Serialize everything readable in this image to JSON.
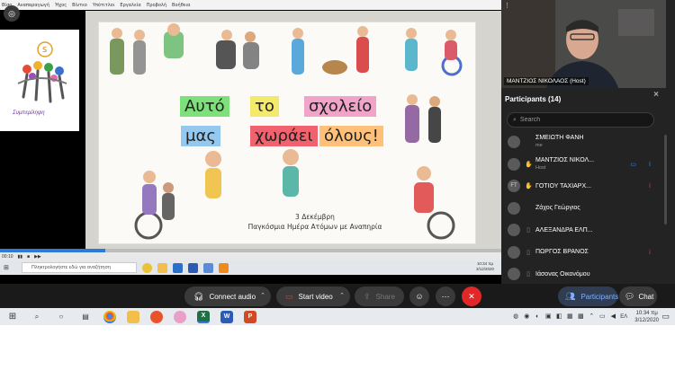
{
  "share": {
    "menu": [
      "Βίσο",
      "Αναπαραγωγή",
      "Ήχος",
      "Βίντεο",
      "Υπότιτλοι",
      "Εργαλεία",
      "Προβολή",
      "Βοήθεια"
    ],
    "logo_caption": "Συμπερίληψη",
    "poster": {
      "title_words": [
        "Αυτό",
        "το",
        "σχολείο",
        "μας",
        "χωράει",
        "όλους!"
      ],
      "caption_line1": "3 Δεκέμβρη",
      "caption_line2": "Παγκόσμια Ημέρα Ατόμων με Αναπηρία"
    },
    "progress": 0.21,
    "time_left": "00:10",
    "taskbar_search_placeholder": "Πληκτρολογήστε εδώ για αναζήτηση",
    "time": "10:34 πμ",
    "date": "3/12/2020",
    "lang": "ΕΛ"
  },
  "camera": {
    "label": "ΜΑΝΤΖΙΟΣ ΝΙΚΟΛΑΟΣ (Host)"
  },
  "participants": {
    "header": "Participants (14)",
    "search_placeholder": "Search",
    "items": [
      {
        "name": "ΣΜΕΙΩΤΗ ΦΑΝΗ",
        "role": "me",
        "initials": "",
        "video": "",
        "mic": ""
      },
      {
        "name": "ΜΑΝΤΖΙΟΣ ΝΙΚΟΛ...",
        "role": "Host",
        "initials": "",
        "video": "on",
        "mic": "on"
      },
      {
        "name": "ΓΟΤΙΟΥ ΤΑΧΙΑΡΧ...",
        "role": "",
        "initials": "FT",
        "video": "",
        "mic": "muted"
      },
      {
        "name": "Ζάχος Γεώργιος",
        "role": "",
        "initials": "",
        "video": "",
        "mic": ""
      },
      {
        "name": "ΑΛΕΞΑΝΔΡΑ ΕΛΠ...",
        "role": "",
        "initials": "",
        "video": "",
        "mic": ""
      },
      {
        "name": "ΠΩΡΓΟΣ ΒΡΑΝΟΣ",
        "role": "",
        "initials": "",
        "video": "",
        "mic": "muted"
      },
      {
        "name": "Ιάσονας Οικονόμου",
        "role": "",
        "initials": "",
        "video": "",
        "mic": ""
      }
    ]
  },
  "toolbar": {
    "connect_audio": "Connect audio",
    "start_video": "Start video",
    "share": "Share",
    "participants": "Participants",
    "chat": "Chat"
  },
  "taskbar": {
    "time": "10:34 πμ",
    "date": "3/12/2020",
    "lang": "ΕΛ"
  },
  "colors": {
    "end_button": "#e02828",
    "participants_active": "#7fb0ff",
    "muted_mic": "#e04040",
    "active_media": "#2d8cff"
  }
}
